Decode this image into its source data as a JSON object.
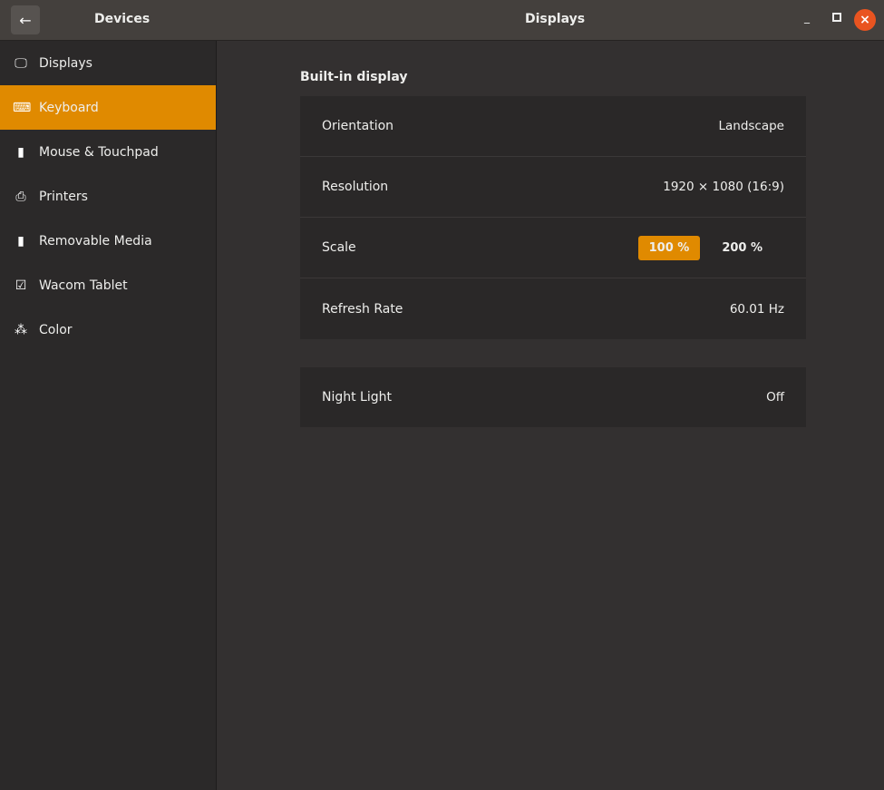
{
  "header": {
    "left_title": "Devices",
    "title": "Displays",
    "back_icon": "arrow-left-icon"
  },
  "sidebar": {
    "items": [
      {
        "label": "Displays",
        "icon": "display-icon",
        "glyph": "🖵"
      },
      {
        "label": "Keyboard",
        "icon": "keyboard-icon",
        "glyph": "⌨",
        "selected": true
      },
      {
        "label": "Mouse & Touchpad",
        "icon": "mouse-icon",
        "glyph": "▮"
      },
      {
        "label": "Printers",
        "icon": "printer-icon",
        "glyph": "⎙"
      },
      {
        "label": "Removable Media",
        "icon": "usb-drive-icon",
        "glyph": "▮"
      },
      {
        "label": "Wacom Tablet",
        "icon": "tablet-icon",
        "glyph": "☑"
      },
      {
        "label": "Color",
        "icon": "color-icon",
        "glyph": "⁂"
      }
    ]
  },
  "accent": "#e08a00",
  "main": {
    "section_title": "Built-in display",
    "orientation": {
      "label": "Orientation",
      "value": "Landscape"
    },
    "resolution": {
      "label": "Resolution",
      "value": "1920 × 1080 (16:9)"
    },
    "scale": {
      "label": "Scale",
      "options": [
        "100 %",
        "200 %"
      ],
      "selected": "100 %"
    },
    "refresh": {
      "label": "Refresh Rate",
      "value": "60.01 Hz"
    },
    "night_light": {
      "label": "Night Light",
      "value": "Off"
    }
  }
}
